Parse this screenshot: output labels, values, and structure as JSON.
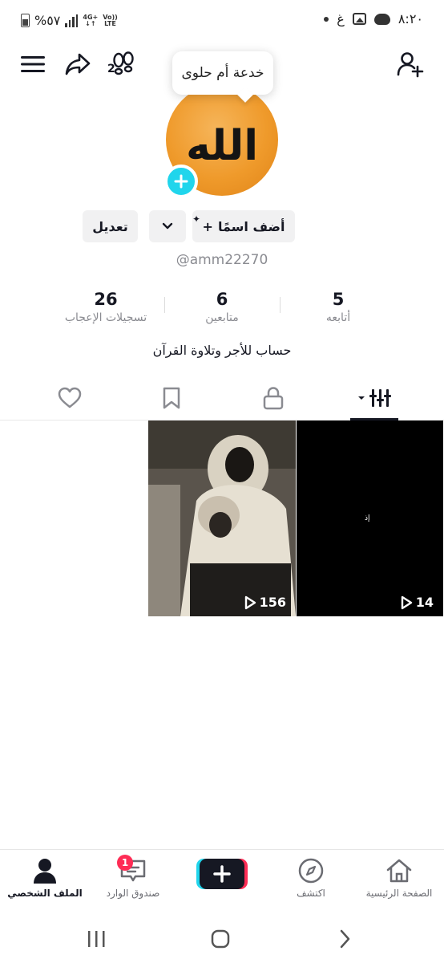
{
  "status_bar": {
    "time": "٨:٢٠",
    "battery": "%٥٧",
    "network_top": "4G+",
    "volte_top": "Vo))",
    "volte_bottom": "LTE",
    "carrier_char": "غ"
  },
  "tooltip": {
    "text": "خدعة أم حلوى"
  },
  "footprint_badge": "2",
  "profile": {
    "avatar_text": "الله",
    "username": "@amm22270",
    "bio": "حساب للأجر وتلاوة القرآن"
  },
  "buttons": {
    "edit": "تعديل",
    "add_name": "أضف اسمًا",
    "add_name_plus": "+"
  },
  "stats": {
    "following": {
      "value": "5",
      "label": "أتابعه"
    },
    "followers": {
      "value": "6",
      "label": "متابعين"
    },
    "likes": {
      "value": "26",
      "label": "تسجيلات الإعجاب"
    }
  },
  "videos": [
    {
      "views": "14",
      "overlay_text": "إذ"
    },
    {
      "views": "156"
    }
  ],
  "bottom_nav": {
    "home": "الصفحة الرئيسية",
    "explore": "اكتشف",
    "inbox": "صندوق الوارد",
    "inbox_badge": "1",
    "profile": "الملف الشخصي"
  },
  "colors": {
    "accent_cyan": "#20d5ec",
    "accent_red": "#fe2c55",
    "text_primary": "#161823",
    "text_secondary": "#8a8b91"
  }
}
